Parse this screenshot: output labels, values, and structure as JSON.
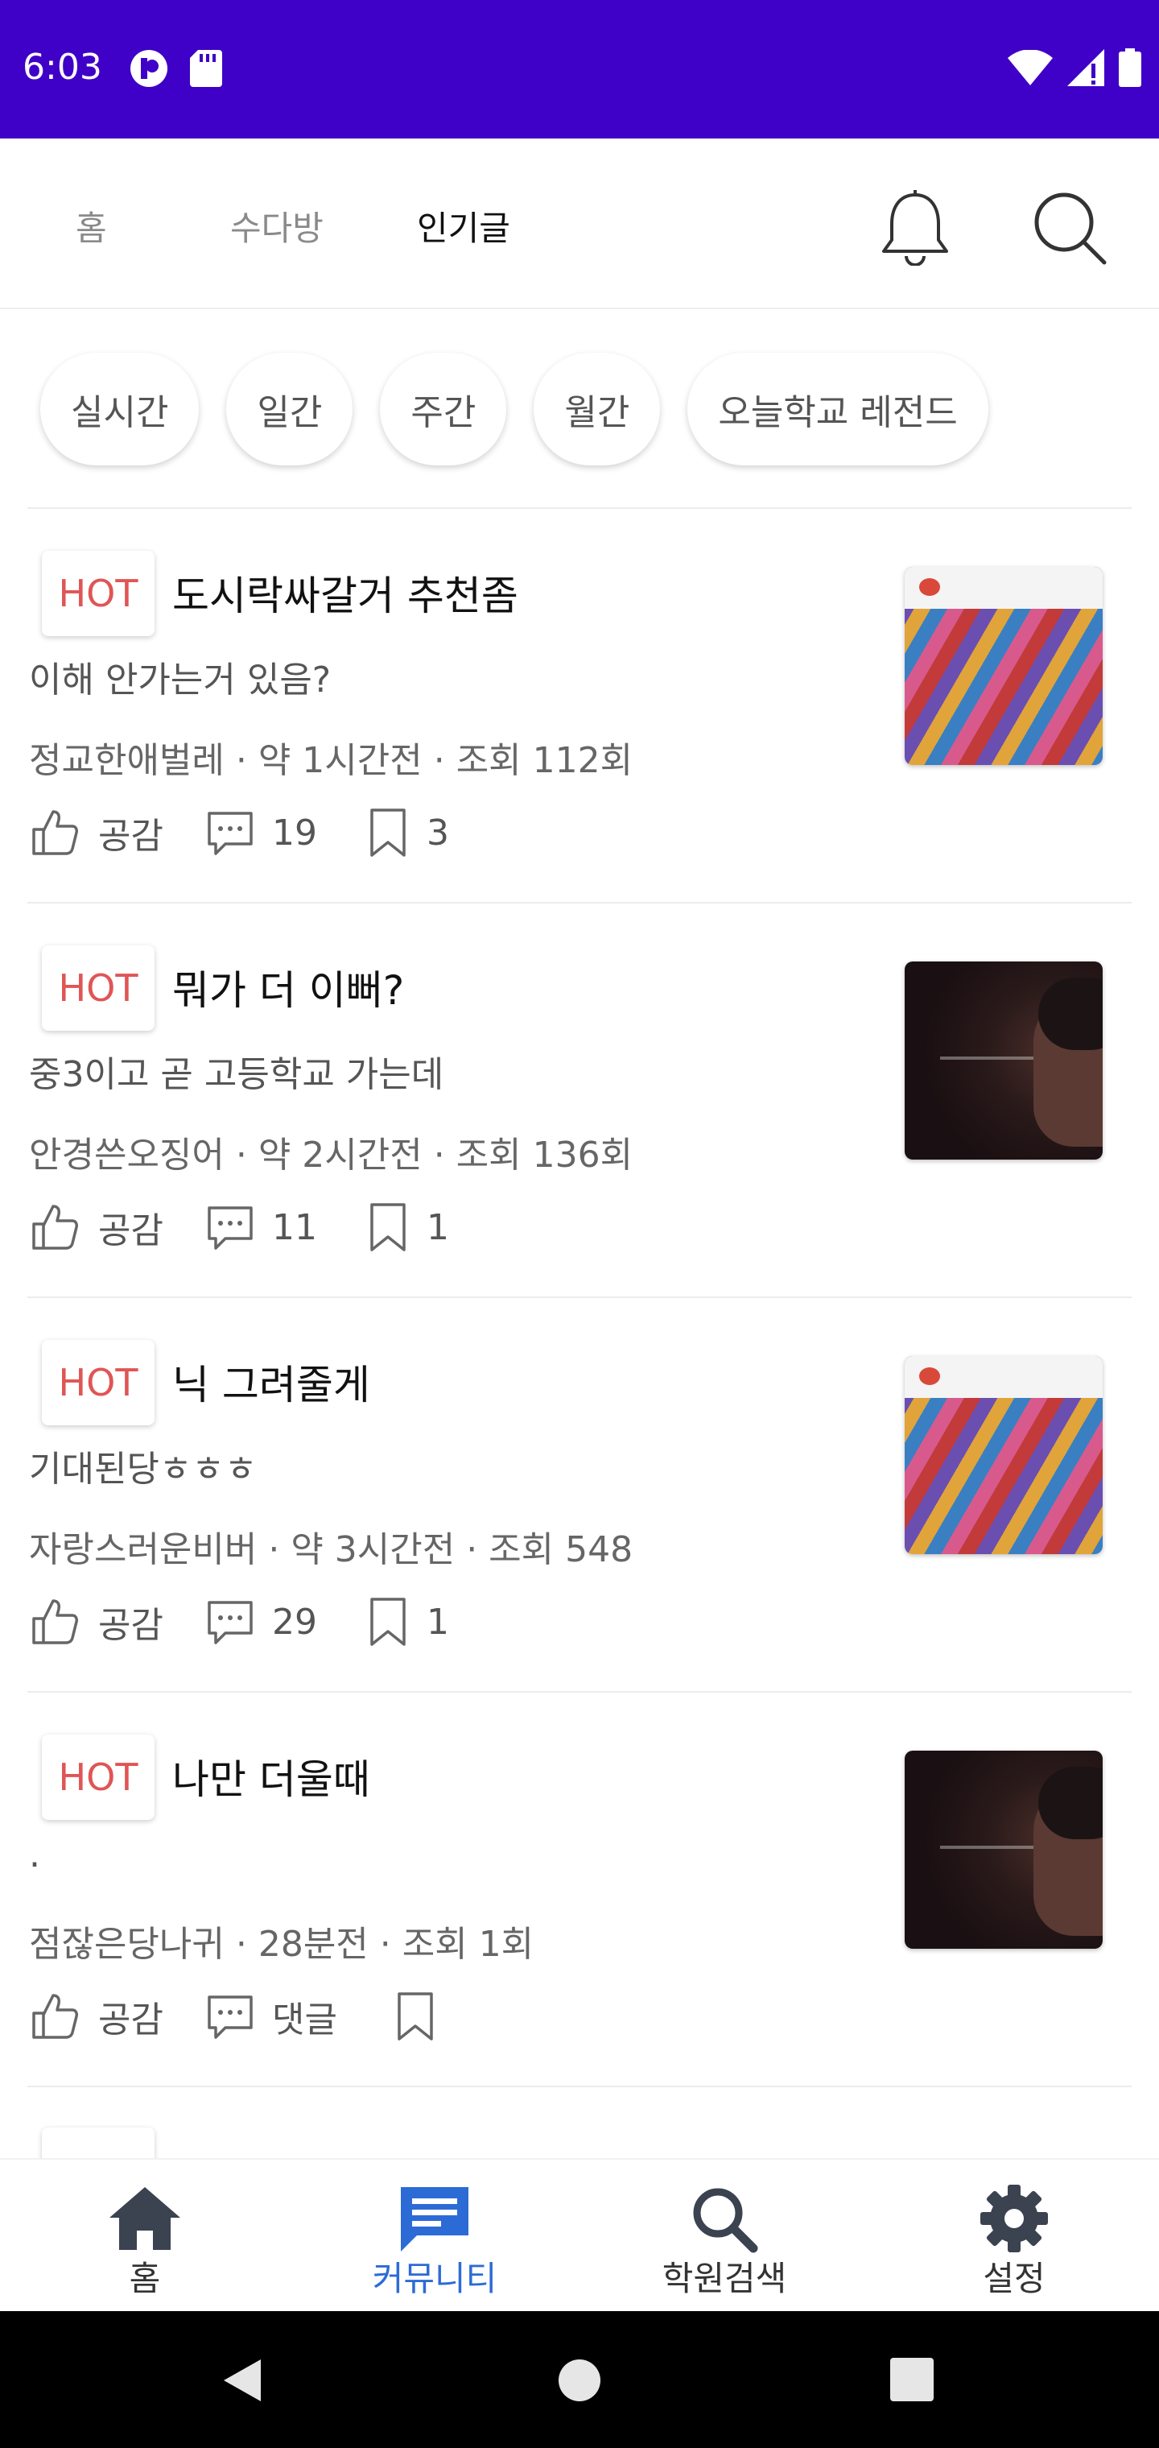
{
  "status_bar": {
    "time": "6:03"
  },
  "top_nav": {
    "tabs": [
      {
        "label": "홈"
      },
      {
        "label": "수다방"
      },
      {
        "label": "인기글"
      }
    ],
    "active_tab": "인기글"
  },
  "filters": [
    {
      "label": "실시간"
    },
    {
      "label": "일간"
    },
    {
      "label": "주간"
    },
    {
      "label": "월간"
    },
    {
      "label": "오늘학교 레전드"
    }
  ],
  "posts": [
    {
      "badge": "HOT",
      "title": "도시락싸갈거 추천좀",
      "body": "이해 안가는거 있음?",
      "meta": "정교한애벌레 · 약 1시간전 · 조회 112회",
      "like_label": "공감",
      "comments": "19",
      "bookmarks": "3",
      "thumb": "candy"
    },
    {
      "badge": "HOT",
      "title": "뭐가 더 이뻐?",
      "body": "중3이고 곧 고등학교 가는데",
      "meta": "안경쓴오징어 · 약 2시간전 · 조회 136회",
      "like_label": "공감",
      "comments": "11",
      "bookmarks": "1",
      "thumb": "dark"
    },
    {
      "badge": "HOT",
      "title": "닉 그려줄게",
      "body": "기대된당ㅎㅎㅎ",
      "meta": "자랑스러운비버 · 약 3시간전 · 조회 548",
      "like_label": "공감",
      "comments": "29",
      "bookmarks": "1",
      "thumb": "candy"
    },
    {
      "badge": "HOT",
      "title": "나만 더울때",
      "body": ".",
      "meta": "점잖은당나귀 · 28분전 · 조회 1회",
      "like_label": "공감",
      "comments": "댓글",
      "bookmarks": "",
      "thumb": "dark"
    }
  ],
  "bottom_nav": {
    "items": [
      {
        "label": "홈",
        "icon": "home-icon"
      },
      {
        "label": "커뮤니티",
        "icon": "chat-icon"
      },
      {
        "label": "학원검색",
        "icon": "search-icon"
      },
      {
        "label": "설정",
        "icon": "gear-icon"
      }
    ],
    "active": "커뮤니티"
  },
  "colors": {
    "status_bar": "#3f00c7",
    "hot": "#e05555",
    "active_nav": "#2c6bd6"
  }
}
